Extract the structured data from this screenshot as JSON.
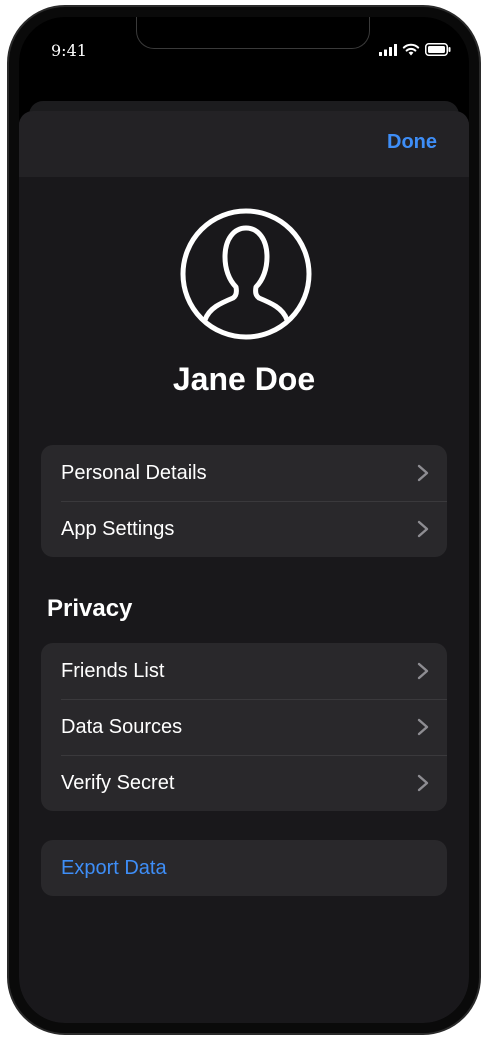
{
  "status_bar": {
    "time": "9:41"
  },
  "header": {
    "done_label": "Done"
  },
  "profile": {
    "name": "Jane Doe"
  },
  "account_group": {
    "items": [
      {
        "label": "Personal Details"
      },
      {
        "label": "App Settings"
      }
    ]
  },
  "privacy": {
    "title": "Privacy",
    "items": [
      {
        "label": "Friends List"
      },
      {
        "label": "Data Sources"
      },
      {
        "label": "Verify Secret"
      }
    ]
  },
  "export": {
    "label": "Export Data"
  },
  "colors": {
    "accent": "#3e8ef7",
    "sheet_background": "#19181b",
    "group_background": "#29282b",
    "text": "#ffffff"
  },
  "icons": {
    "avatar": "person-circle-icon",
    "chevron": "chevron-right-icon",
    "signal": "cellular-signal-icon",
    "wifi": "wifi-icon",
    "battery": "battery-icon"
  }
}
